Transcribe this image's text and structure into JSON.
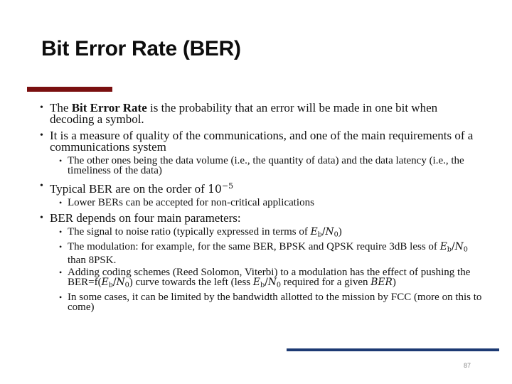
{
  "slide": {
    "title": "Bit Error Rate (BER)",
    "page_number": "87",
    "bullet": "•",
    "colors": {
      "accent_left": "#7a1010",
      "accent_right": "#1c3a73"
    }
  },
  "items": [
    {
      "parts": [
        "The ",
        "Bit Error Rate",
        " is the probability that an error will be made in one bit when decoding a symbol."
      ]
    },
    {
      "text": "It is a measure of quality of the communications, and one of the main requirements of a communications system",
      "sub": [
        "The other ones being the data volume (i.e., the quantity of data) and the data latency (i.e., the timeliness of the data)"
      ]
    },
    {
      "text": "Typical BER are on the order of ",
      "math_base": "10",
      "math_exp": "−5",
      "sub": [
        "Lower BERs can be accepted for non-critical applications"
      ]
    },
    {
      "text": "BER depends on four main parameters:",
      "sub4": {
        "a_pre": "The signal to noise ratio (typically expressed in terms of ",
        "a_post": ")",
        "b_pre": "The modulation: for example, for the same BER, BPSK and QPSK require 3dB less of ",
        "b_post": " than 8PSK.",
        "c_pre": "Adding coding schemes (Reed Solomon, Viterbi) to a modulation has the effect of pushing the BER=f(",
        "c_mid": ") curve towards the left (less ",
        "c_mid2": " required for a given ",
        "c_post": ")",
        "d": "In some cases, it can be limited by the bandwidth allotted to the mission by FCC (more on this to come)"
      }
    }
  ],
  "math": {
    "E": "E",
    "b": "b",
    "N": "N",
    "zero": "0",
    "slash": "/",
    "ber": "BER"
  }
}
